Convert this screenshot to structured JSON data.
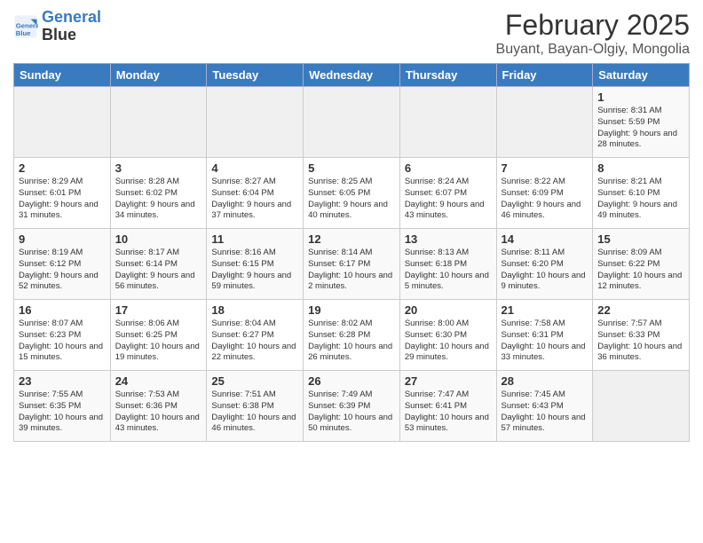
{
  "header": {
    "logo_line1": "General",
    "logo_line2": "Blue",
    "title": "February 2025",
    "subtitle": "Buyant, Bayan-Olgiy, Mongolia"
  },
  "weekdays": [
    "Sunday",
    "Monday",
    "Tuesday",
    "Wednesday",
    "Thursday",
    "Friday",
    "Saturday"
  ],
  "weeks": [
    [
      {
        "day": "",
        "info": ""
      },
      {
        "day": "",
        "info": ""
      },
      {
        "day": "",
        "info": ""
      },
      {
        "day": "",
        "info": ""
      },
      {
        "day": "",
        "info": ""
      },
      {
        "day": "",
        "info": ""
      },
      {
        "day": "1",
        "info": "Sunrise: 8:31 AM\nSunset: 5:59 PM\nDaylight: 9 hours and 28 minutes."
      }
    ],
    [
      {
        "day": "2",
        "info": "Sunrise: 8:29 AM\nSunset: 6:01 PM\nDaylight: 9 hours and 31 minutes."
      },
      {
        "day": "3",
        "info": "Sunrise: 8:28 AM\nSunset: 6:02 PM\nDaylight: 9 hours and 34 minutes."
      },
      {
        "day": "4",
        "info": "Sunrise: 8:27 AM\nSunset: 6:04 PM\nDaylight: 9 hours and 37 minutes."
      },
      {
        "day": "5",
        "info": "Sunrise: 8:25 AM\nSunset: 6:05 PM\nDaylight: 9 hours and 40 minutes."
      },
      {
        "day": "6",
        "info": "Sunrise: 8:24 AM\nSunset: 6:07 PM\nDaylight: 9 hours and 43 minutes."
      },
      {
        "day": "7",
        "info": "Sunrise: 8:22 AM\nSunset: 6:09 PM\nDaylight: 9 hours and 46 minutes."
      },
      {
        "day": "8",
        "info": "Sunrise: 8:21 AM\nSunset: 6:10 PM\nDaylight: 9 hours and 49 minutes."
      }
    ],
    [
      {
        "day": "9",
        "info": "Sunrise: 8:19 AM\nSunset: 6:12 PM\nDaylight: 9 hours and 52 minutes."
      },
      {
        "day": "10",
        "info": "Sunrise: 8:17 AM\nSunset: 6:14 PM\nDaylight: 9 hours and 56 minutes."
      },
      {
        "day": "11",
        "info": "Sunrise: 8:16 AM\nSunset: 6:15 PM\nDaylight: 9 hours and 59 minutes."
      },
      {
        "day": "12",
        "info": "Sunrise: 8:14 AM\nSunset: 6:17 PM\nDaylight: 10 hours and 2 minutes."
      },
      {
        "day": "13",
        "info": "Sunrise: 8:13 AM\nSunset: 6:18 PM\nDaylight: 10 hours and 5 minutes."
      },
      {
        "day": "14",
        "info": "Sunrise: 8:11 AM\nSunset: 6:20 PM\nDaylight: 10 hours and 9 minutes."
      },
      {
        "day": "15",
        "info": "Sunrise: 8:09 AM\nSunset: 6:22 PM\nDaylight: 10 hours and 12 minutes."
      }
    ],
    [
      {
        "day": "16",
        "info": "Sunrise: 8:07 AM\nSunset: 6:23 PM\nDaylight: 10 hours and 15 minutes."
      },
      {
        "day": "17",
        "info": "Sunrise: 8:06 AM\nSunset: 6:25 PM\nDaylight: 10 hours and 19 minutes."
      },
      {
        "day": "18",
        "info": "Sunrise: 8:04 AM\nSunset: 6:27 PM\nDaylight: 10 hours and 22 minutes."
      },
      {
        "day": "19",
        "info": "Sunrise: 8:02 AM\nSunset: 6:28 PM\nDaylight: 10 hours and 26 minutes."
      },
      {
        "day": "20",
        "info": "Sunrise: 8:00 AM\nSunset: 6:30 PM\nDaylight: 10 hours and 29 minutes."
      },
      {
        "day": "21",
        "info": "Sunrise: 7:58 AM\nSunset: 6:31 PM\nDaylight: 10 hours and 33 minutes."
      },
      {
        "day": "22",
        "info": "Sunrise: 7:57 AM\nSunset: 6:33 PM\nDaylight: 10 hours and 36 minutes."
      }
    ],
    [
      {
        "day": "23",
        "info": "Sunrise: 7:55 AM\nSunset: 6:35 PM\nDaylight: 10 hours and 39 minutes."
      },
      {
        "day": "24",
        "info": "Sunrise: 7:53 AM\nSunset: 6:36 PM\nDaylight: 10 hours and 43 minutes."
      },
      {
        "day": "25",
        "info": "Sunrise: 7:51 AM\nSunset: 6:38 PM\nDaylight: 10 hours and 46 minutes."
      },
      {
        "day": "26",
        "info": "Sunrise: 7:49 AM\nSunset: 6:39 PM\nDaylight: 10 hours and 50 minutes."
      },
      {
        "day": "27",
        "info": "Sunrise: 7:47 AM\nSunset: 6:41 PM\nDaylight: 10 hours and 53 minutes."
      },
      {
        "day": "28",
        "info": "Sunrise: 7:45 AM\nSunset: 6:43 PM\nDaylight: 10 hours and 57 minutes."
      },
      {
        "day": "",
        "info": ""
      }
    ]
  ]
}
